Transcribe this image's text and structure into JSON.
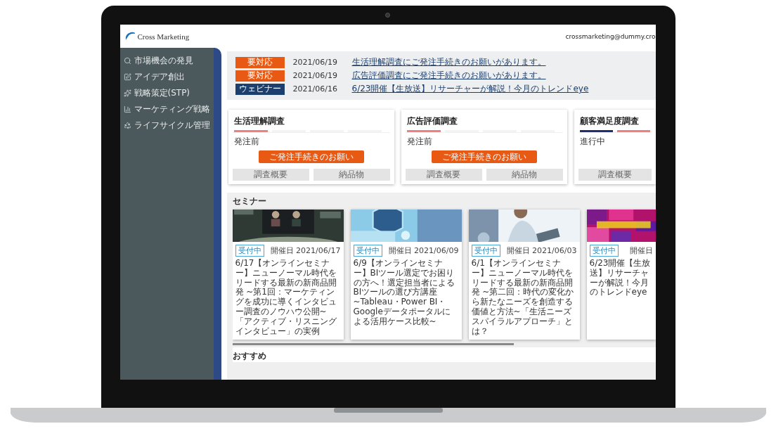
{
  "header": {
    "logo": "Cross Marketing",
    "user_email": "crossmarketing@dummy.cro"
  },
  "sidebar": {
    "items": [
      {
        "label": "市場機会の発見",
        "selected": false
      },
      {
        "label": "アイデア創出",
        "selected": false
      },
      {
        "label": "戦略策定(STP)",
        "selected": false
      },
      {
        "label": "マーケティング戦略",
        "selected": false
      },
      {
        "label": "ライフサイクル管理",
        "selected": false
      }
    ]
  },
  "notices": [
    {
      "tag": "要対応",
      "kind": "action",
      "date": "2021/06/19",
      "text": "生活理解調査にご発注手続きのお願いがあります。"
    },
    {
      "tag": "要対応",
      "kind": "action",
      "date": "2021/06/19",
      "text": "広告評価調査にご発注手続きのお願いがあります。"
    },
    {
      "tag": "ウェビナー",
      "kind": "webinar",
      "date": "2021/06/16",
      "text": "6/23開催【生放送】リサーチャーが解説！今月のトレンドeye"
    }
  ],
  "surveys": [
    {
      "title": "生活理解調査",
      "steps": [
        {
          "done": false,
          "active": true
        },
        {
          "done": false,
          "active": false
        },
        {
          "done": false,
          "active": false
        },
        {
          "done": false,
          "active": false
        }
      ],
      "status": "発注前",
      "action": "ご発注手続きのお願い",
      "buttons": [
        {
          "label": "調査概要",
          "disabled": true
        },
        {
          "label": "納品物",
          "disabled": true
        }
      ]
    },
    {
      "title": "広告評価調査",
      "steps": [
        {
          "done": false,
          "active": true
        },
        {
          "done": false,
          "active": false
        },
        {
          "done": false,
          "active": false
        },
        {
          "done": false,
          "active": false
        }
      ],
      "status": "発注前",
      "action": "ご発注手続きのお願い",
      "buttons": [
        {
          "label": "調査概要",
          "disabled": true
        },
        {
          "label": "納品物",
          "disabled": true
        }
      ]
    },
    {
      "title": "顧客満足度調査",
      "steps": [
        {
          "done": true,
          "active": false
        },
        {
          "done": false,
          "active": true
        }
      ],
      "status": "進行中",
      "buttons": [
        {
          "label": "調査概要",
          "disabled": true
        }
      ]
    }
  ],
  "seminar_heading": "セミナー",
  "seminars": [
    {
      "kind": "meeting",
      "tag": "受付中",
      "date": "開催日 2021/06/17",
      "text": "6/17【オンラインセミナー】ニューノーマル時代をリードする最新の新商品開発 ~第1回：マーケティングを成功に導くインタビュー調査のノウハウ公開~「アクティブ・リスニングインタビュー」の実例"
    },
    {
      "kind": "hexagon",
      "tag": "受付中",
      "date": "開催日 2021/06/09",
      "text": "6/9【オンラインセミナー】BIツール選定でお困りの方へ！選定担当者によるBIツールの選び方講座 ~Tableau・Power BI・Googleデータポータルによる活用ケース比較~"
    },
    {
      "kind": "tablet",
      "tag": "受付中",
      "date": "開催日 2021/06/03",
      "text": "6/1【オンラインセミナー】ニューノーマル時代をリードする最新の新商品開発 ~第二回：時代の変化から新たなニーズを創造する価値と方法~「生活ニーズスパイラルアプローチ」とは？"
    },
    {
      "kind": "mosaic",
      "tag": "受付中",
      "date": "開催日",
      "text": "6/23開催【生放送】リサーチャーが解説！今月のトレンドeye"
    }
  ],
  "recommend_heading": "おすすめ"
}
